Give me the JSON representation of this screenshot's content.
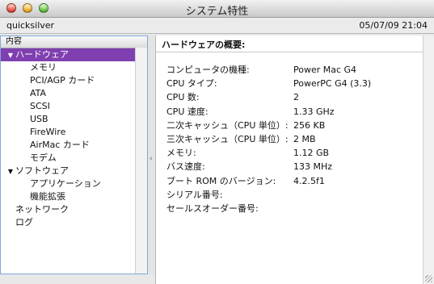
{
  "window": {
    "title": "システム特性"
  },
  "infobar": {
    "host": "quicksilver",
    "datetime": "05/07/09 21:04"
  },
  "sidebar": {
    "header": "内容",
    "items": [
      {
        "label": "ハードウェア",
        "triangle": "▼",
        "level": 0,
        "selected": true
      },
      {
        "label": "メモリ",
        "level": 1
      },
      {
        "label": "PCI/AGP カード",
        "level": 1
      },
      {
        "label": "ATA",
        "level": 1
      },
      {
        "label": "SCSI",
        "level": 1
      },
      {
        "label": "USB",
        "level": 1
      },
      {
        "label": "FireWire",
        "level": 1
      },
      {
        "label": "AirMac カード",
        "level": 1
      },
      {
        "label": "モデム",
        "level": 1
      },
      {
        "label": "ソフトウェア",
        "triangle": "▼",
        "level": 0
      },
      {
        "label": "アプリケーション",
        "level": 1
      },
      {
        "label": "機能拡張",
        "level": 1
      },
      {
        "label": "ネットワーク",
        "level": 0
      },
      {
        "label": "ログ",
        "level": 0
      }
    ]
  },
  "splitter": {
    "glyph": "‹"
  },
  "content": {
    "heading": "ハードウェアの概要:",
    "rows": [
      {
        "label": "コンピュータの機種:",
        "value": "Power Mac G4"
      },
      {
        "label": "CPU タイプ:",
        "value": "PowerPC G4  (3.3)"
      },
      {
        "label": "CPU 数:",
        "value": "2"
      },
      {
        "label": "CPU 速度:",
        "value": "1.33 GHz"
      },
      {
        "label": "二次キャッシュ（CPU 単位）:",
        "value": "256 KB"
      },
      {
        "label": "三次キャッシュ（CPU 単位）:",
        "value": "2 MB"
      },
      {
        "label": "メモリ:",
        "value": "1.12 GB"
      },
      {
        "label": "バス速度:",
        "value": "133 MHz"
      },
      {
        "label": "ブート ROM のバージョン:",
        "value": "4.2.5f1"
      },
      {
        "label": "シリアル番号:",
        "value": ""
      },
      {
        "label": "セールスオーダー番号:",
        "value": ""
      }
    ]
  },
  "colors": {
    "selection": "#7f3fb0",
    "sidebar_border": "#7fa7d9"
  }
}
